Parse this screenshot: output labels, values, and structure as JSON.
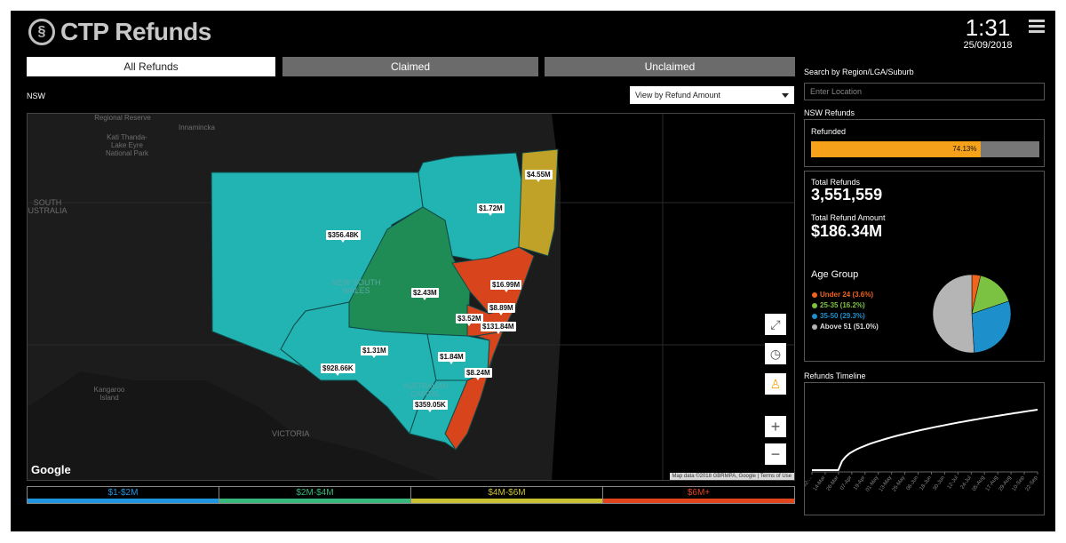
{
  "app": {
    "title": "CTP Refunds",
    "logo_glyph": "§"
  },
  "clock": {
    "time": "1:31",
    "date": "25/09/2018"
  },
  "tabs": [
    {
      "label": "All Refunds",
      "active": true
    },
    {
      "label": "Claimed",
      "active": false
    },
    {
      "label": "Unclaimed",
      "active": false
    }
  ],
  "region": "NSW",
  "view_select": {
    "value": "View by Refund Amount"
  },
  "map": {
    "place_labels": [
      "Regional Reserve",
      "Innamincka",
      "Kati Thanda-Lake Eyre National Park",
      "SOUTH USTRALIA",
      "NEW SOUTH WALES",
      "AUSTRALIAN CAPITAL",
      "Kangaroo Island",
      "VICTORIA"
    ],
    "regions": [
      {
        "amount": "$4.55M",
        "band": "$4M-$6M"
      },
      {
        "amount": "$1.72M",
        "band": "$1-$2M"
      },
      {
        "amount": "$356.48K",
        "band": "$1-$2M"
      },
      {
        "amount": "$16.99M",
        "band": "$6M+"
      },
      {
        "amount": "$2.43M",
        "band": "$2M-$4M"
      },
      {
        "amount": "$8.89M",
        "band": "$6M+"
      },
      {
        "amount": "$3.52M",
        "band": "$2M-$4M"
      },
      {
        "amount": "$131.84M",
        "band": "$6M+"
      },
      {
        "amount": "$1.31M",
        "band": "$1-$2M"
      },
      {
        "amount": "$1.84M",
        "band": "$1-$2M"
      },
      {
        "amount": "$928.66K",
        "band": "$1-$2M"
      },
      {
        "amount": "$8.24M",
        "band": "$6M+"
      },
      {
        "amount": "$359.05K",
        "band": "$1-$2M"
      }
    ],
    "google": "Google",
    "attribution": "Map data ©2018 GBRMPA, Google | Terms of Use",
    "controls": [
      "fullscreen-icon",
      "clock-icon",
      "pegman-icon",
      "zoom-in-icon",
      "zoom-out-icon"
    ]
  },
  "legend": [
    {
      "label": "$1-$2M",
      "color": "#2196e0"
    },
    {
      "label": "$2M-$4M",
      "color": "#38b87c"
    },
    {
      "label": "$4M-$6M",
      "color": "#c9c132"
    },
    {
      "label": "$6M+",
      "color": "#e0451d"
    }
  ],
  "side": {
    "search_label": "Search by Region/LGA/Suburb",
    "search_placeholder": "Enter Location",
    "panel_title": "NSW Refunds",
    "refunded_label": "Refunded",
    "refunded_pct": "74.13%",
    "refunded_fraction": 0.7413,
    "total_refunds_label": "Total Refunds",
    "total_refunds": "3,551,559",
    "total_amount_label": "Total Refund Amount",
    "total_amount": "$186.34M",
    "age_group_title": "Age Group",
    "age_groups": [
      {
        "label": "Under 24 (3.6%)",
        "value": 3.6,
        "color": "#f0641e"
      },
      {
        "label": "25-35 (16.2%)",
        "value": 16.2,
        "color": "#7cc242"
      },
      {
        "label": "35-50 (29.3%)",
        "value": 29.3,
        "color": "#1d8fcb"
      },
      {
        "label": "Above 51 (51.0%)",
        "value": 51.0,
        "color": "#b5b5b5"
      }
    ],
    "timeline_title": "Refunds Timeline",
    "timeline_ticks": [
      "02-...",
      "14-Mar",
      "26-Mar",
      "07-Apr",
      "19-Apr",
      "01-May",
      "13-May",
      "25-May",
      "06-Jun",
      "18-Jun",
      "30-Jun",
      "12-Jul",
      "24-Jul",
      "05-Aug",
      "17-Aug",
      "29-Aug",
      "10-Sep",
      "22-Sep"
    ]
  }
}
